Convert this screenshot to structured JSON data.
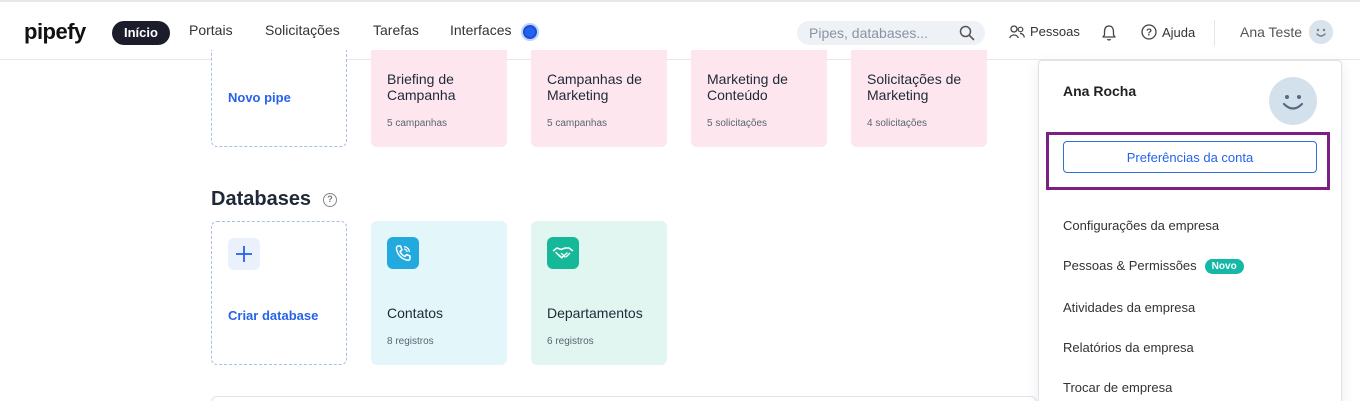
{
  "nav": {
    "logo": "pipefy",
    "active": "Início",
    "items": [
      "Portais",
      "Solicitações",
      "Tarefas",
      "Interfaces"
    ]
  },
  "search": {
    "placeholder": "Pipes, databases..."
  },
  "header": {
    "people": "Pessoas",
    "help": "Ajuda",
    "user": "Ana Teste"
  },
  "pipes": {
    "new_label": "Novo pipe",
    "cards": [
      {
        "title": "Briefing de Campanha",
        "sub": "5 campanhas"
      },
      {
        "title": "Campanhas de Marketing",
        "sub": "5 campanhas"
      },
      {
        "title": "Marketing de Conteúdo",
        "sub": "5 solicitações"
      },
      {
        "title": "Solicitações de Marketing",
        "sub": "4 solicitações"
      }
    ]
  },
  "databases": {
    "title": "Databases",
    "create_label": "Criar database",
    "cards": [
      {
        "title": "Contatos",
        "sub": "8 registros",
        "icon": "phone-icon",
        "color": "#22a9dd"
      },
      {
        "title": "Departamentos",
        "sub": "6 registros",
        "icon": "handshake-icon",
        "color": "#16b89a"
      }
    ]
  },
  "menu": {
    "user": "Ana Rocha",
    "preferences": "Preferências da conta",
    "items": [
      "Configurações da empresa",
      "Pessoas & Permissões",
      "Atividades da empresa",
      "Relatórios da empresa",
      "Trocar de empresa"
    ],
    "new_badge": "Novo"
  },
  "colors": {
    "accent": "#2563eb",
    "highlight": "#7b1f84",
    "badge": "#14b8a6"
  }
}
